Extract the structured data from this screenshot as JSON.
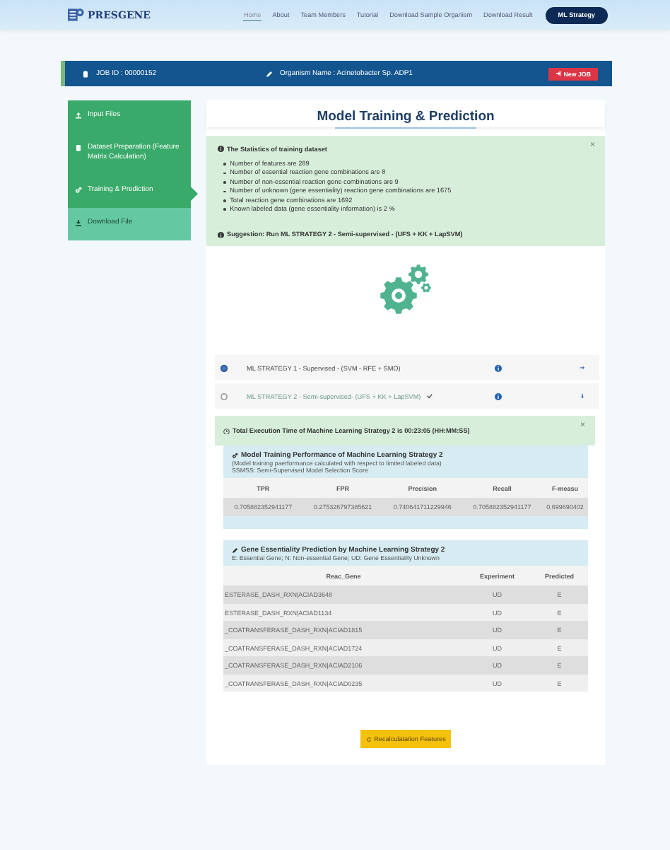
{
  "header": {
    "logo": "PRESGENE",
    "nav": [
      {
        "label": "Home",
        "selected": true
      },
      {
        "label": "About",
        "selected": false
      },
      {
        "label": "Team Members",
        "selected": false
      },
      {
        "label": "Tutorial",
        "selected": false
      },
      {
        "label": "Download Sample Organism",
        "selected": false
      },
      {
        "label": "Download Result",
        "selected": false
      }
    ],
    "action_button": "ML Strategy"
  },
  "job_bar": {
    "job_id": "JOB ID : 00000152",
    "organism": "Organism Name : Acinetobacter Sp. ADP1",
    "new_job_button": "New JOB"
  },
  "sidebar": {
    "items": [
      {
        "label": "Input Files",
        "kind": "upload",
        "selected": false,
        "pending": false
      },
      {
        "label": "Dataset Preparation (Feature Matrix Calculation)",
        "kind": "list",
        "selected": false,
        "pending": false
      },
      {
        "label": "Training & Prediction",
        "kind": "gears",
        "selected": true,
        "pending": false
      },
      {
        "label": "Download File",
        "kind": "download",
        "selected": false,
        "pending": true
      }
    ]
  },
  "main": {
    "title": "Model Training & Prediction",
    "stats_alert": {
      "heading": "The Statistics of training dataset",
      "close": "×",
      "items": [
        "Number of features are 289",
        "Number of essential reaction gene combinations are 8",
        "Number of non-essential reaction gene combinations are 9",
        "Number of unknown (gene essentiality) reaction gene combinations are 1675",
        "Total reaction gene combinations are 1692",
        "Known labeled data (gene essentiality information) is 2 %"
      ],
      "suggestion": "Suggestion: Run ML STRATEGY 2 - Semi-supervised - (UFS + KK + LapSVM)"
    },
    "strategies": [
      {
        "label": "ML STRATEGY 1 - Supervised - (SVM - RFE + SMO)",
        "selected": true,
        "done": false,
        "expanded": false
      },
      {
        "label": "ML STRATEGY 2 - Semi-supervised- (UFS + KK + LapSVM)",
        "selected": false,
        "done": true,
        "expanded": true
      }
    ],
    "exec_alert": {
      "text": "Total Execution Time of Machine Learning Strategy 2 is 00:23:05 (HH:MM:SS)",
      "close": "×"
    },
    "performance": {
      "title": "Model Training Performance of Machine Learning Strategy 2",
      "note": "(Model training paerformance calculated with respect to limited labeled data)",
      "subnote": "SSMSS: Semi-Supervised Model Selection Score",
      "columns": [
        "TPR",
        "FPR",
        "Precision",
        "Recall",
        "F-measu"
      ],
      "rows": [
        [
          "0.705882352941177",
          "0.275326797385621",
          "0.740641711229946",
          "0.705882352941177",
          "0.699690402"
        ]
      ]
    },
    "prediction": {
      "title": "Gene Essentiality Prediction by Machine Learning Strategy 2",
      "legend": "E: Essential Gene; N: Non-essential Gene; UD: Gene Essentiality Unknown",
      "columns": [
        "Reac_Gene",
        "Experiment",
        "Predicted"
      ],
      "rows": [
        [
          "ESTERASE_DASH_RXN|ACIAD3648",
          "UD",
          "E"
        ],
        [
          "ESTERASE_DASH_RXN|ACIAD1134",
          "UD",
          "E"
        ],
        [
          "_COATRANSFERASE_DASH_RXN|ACIAD1815",
          "UD",
          "E"
        ],
        [
          "_COATRANSFERASE_DASH_RXN|ACIAD1724",
          "UD",
          "E"
        ],
        [
          "_COATRANSFERASE_DASH_RXN|ACIAD2106",
          "UD",
          "E"
        ],
        [
          "_COATRANSFERASE_DASH_RXN|ACIAD0235",
          "UD",
          "E"
        ]
      ]
    },
    "recalc_button": "Recalculatation Features"
  }
}
